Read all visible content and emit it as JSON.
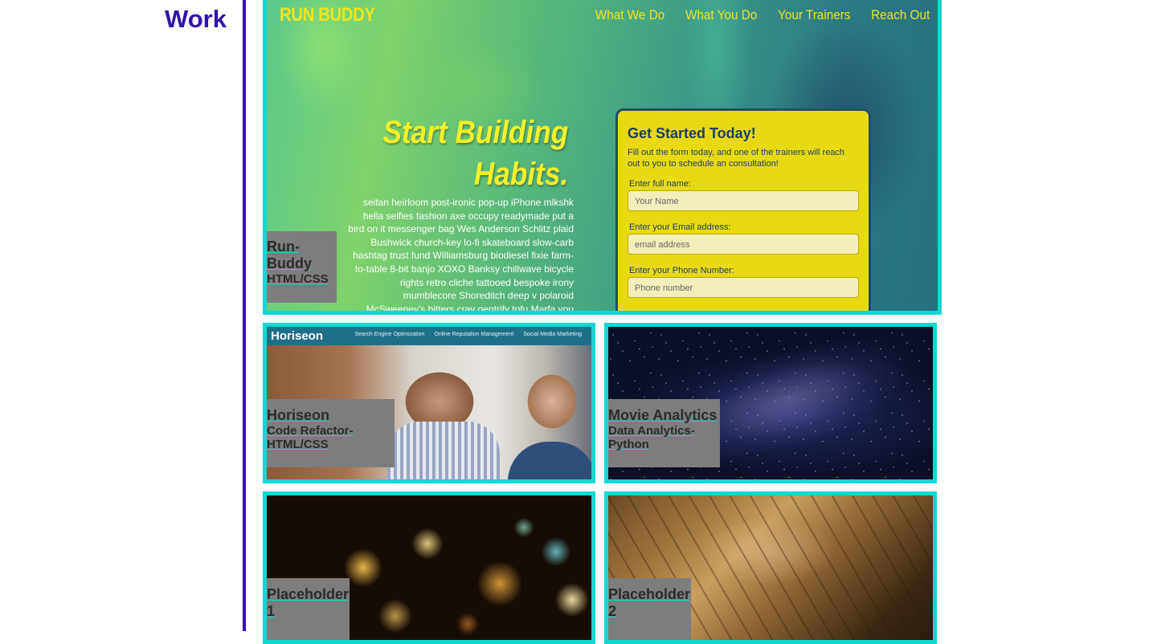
{
  "section": {
    "heading": "Work"
  },
  "colors": {
    "accent": "#3313ab",
    "card_border": "#11d8d0",
    "caption_bg": "#7d7d7d"
  },
  "cards": {
    "featured": {
      "title": "Run-Buddy",
      "subtitle": "HTML/CSS",
      "screenshot": {
        "logo": "RUN BUDDY",
        "nav": [
          "What We Do",
          "What You Do",
          "Your Trainers",
          "Reach Out"
        ],
        "headline_line1": "Start Building",
        "headline_line2": "Habits.",
        "body": "seitan heirloom post-ironic pop-up iPhone mlkshk hella selfies fashion axe occupy readymade put a bird on it messenger bag Wes Anderson Schlitz plaid Bushwick church-key lo-fi skateboard slow-carb hashtag trust fund Williamsburg biodiesel fixie farm-to-table 8-bit banjo XOXO Banksy chillwave bicycle rights retro cliche tattooed bespoke irony mumblecore Shoreditch deep v polaroid McSweeney's bitters cray gentrify tofu Marfa you probably",
        "form_title": "Get Started Today!",
        "form_desc": "Fill out the form today, and one of the trainers will reach out to you to schedule an consultation!",
        "fields": [
          {
            "label": "Enter full name:",
            "placeholder": "Your Name"
          },
          {
            "label": "Enter your Email address:",
            "placeholder": "email address"
          },
          {
            "label": "Enter your Phone Number:",
            "placeholder": "Phone number"
          }
        ]
      }
    },
    "horiseon": {
      "title": "Horiseon",
      "subtitle": "Code Refactor-HTML/CSS",
      "screenshot": {
        "logo": "Horiseon",
        "nav": [
          "Search Engine Optimization",
          "Online Reputation Management",
          "Social Media Marketing"
        ]
      }
    },
    "movie": {
      "title": "Movie Analytics",
      "subtitle": "Data Analytics-Python"
    },
    "placeholder1": {
      "title": "Placeholder 1"
    },
    "placeholder2": {
      "title": "Placeholder 2"
    }
  }
}
